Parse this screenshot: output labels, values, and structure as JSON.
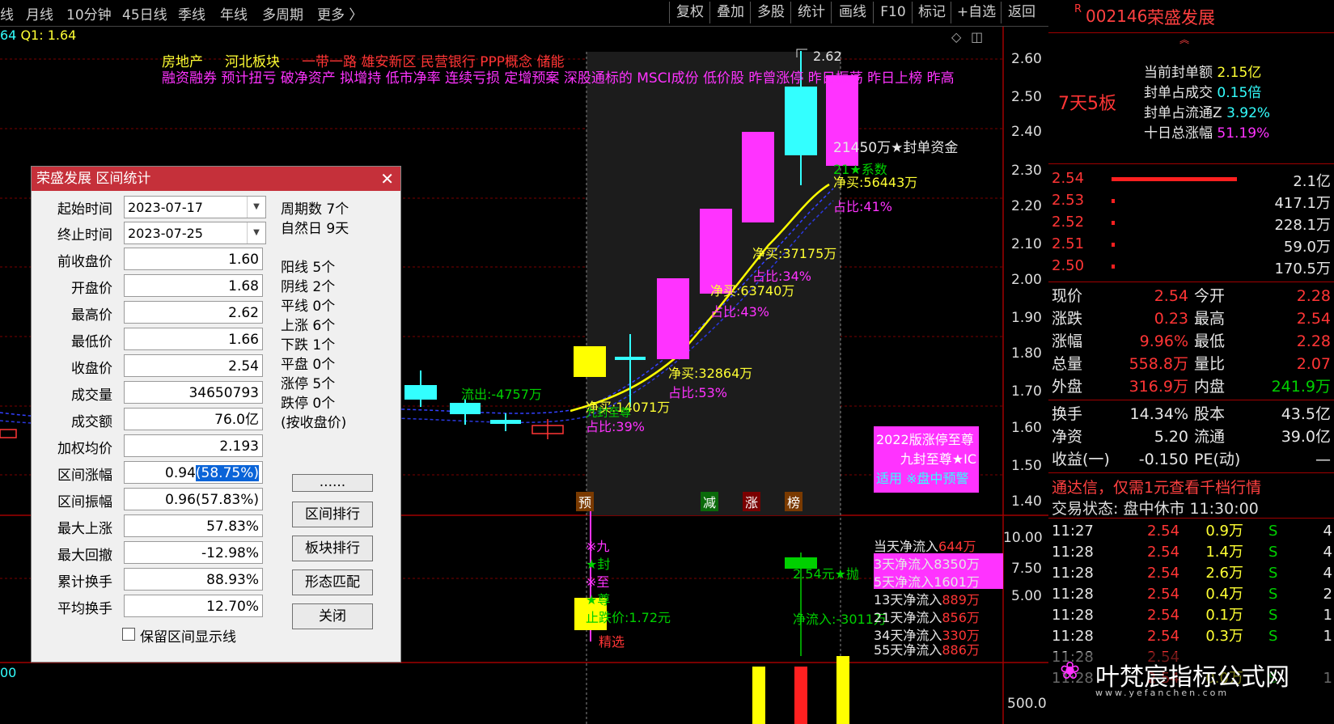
{
  "topbar": {
    "left_items": [
      "线",
      "月线",
      "10分钟",
      "45日线",
      "季线",
      "年线",
      "多周期",
      "更多 〉"
    ],
    "right_items": [
      "复权",
      "叠加",
      "多股",
      "统计",
      "画线",
      "F10",
      "标记",
      "+自选",
      "返回"
    ]
  },
  "chart_header": {
    "q_label_prefix": "64",
    "q_label": "Q1: 1.64"
  },
  "tags_line1": [
    "房地产",
    "河北板块",
    "一带一路",
    "雄安新区",
    "民营银行",
    "PPP概念",
    "储能"
  ],
  "tags_line2": "融资融券 预计扭亏 破净资产 拟增持 低市净率 连续亏损 定增预案 深股通标的 MSCI成份 低价股 昨曾涨停 昨日振荡 昨日上榜 昨高",
  "price_axis": [
    "2.60",
    "2.50",
    "2.40",
    "2.30",
    "2.20",
    "2.10",
    "2.00",
    "1.90",
    "1.80",
    "1.70",
    "1.60",
    "1.50",
    "1.40"
  ],
  "indicator_axis": [
    "10.00",
    "7.50",
    "5.00"
  ],
  "volume_axis": [
    "500.0"
  ],
  "vol_header": "00",
  "peak_label": "2.62",
  "annotations": {
    "outflow": "流出:-4757万",
    "net1": "净买:14071万",
    "ratio1": "占比:39%",
    "nine_seal": "九封至尊",
    "net2": "净买:32864万",
    "ratio2": "占比:53%",
    "net3": "净买:63740万",
    "ratio3": "占比:43%",
    "net4": "净买:37175万",
    "ratio4": "占比:34%",
    "seal_fund": "21450万★封单资金",
    "system": "21★系数",
    "net5": "净买:56443万",
    "ratio5": "占比:41%"
  },
  "markers": [
    "预",
    "减",
    "涨",
    "榜"
  ],
  "promo_box": {
    "line1": "2022版涨停至尊",
    "line2": "九封至尊★IC",
    "line3": "适用",
    "line4": "※盘中预警"
  },
  "indicator_annotations": {
    "v1": "※九",
    "v2": "★封",
    "v3": "※至",
    "v4": "★尊",
    "stop_price": "止跌价:1.72元",
    "sell_signal": "2.54元★抛",
    "net_inflow": "净流入:-3011万",
    "select": "精选"
  },
  "flow_list": [
    {
      "label": "当天净流入",
      "value": "644万"
    },
    {
      "label": "3天净流入",
      "value": "8350万"
    },
    {
      "label": "5天净流入",
      "value": "1601万"
    },
    {
      "label": "13天净流入",
      "value": "889万"
    },
    {
      "label": "21天净流入",
      "value": "856万"
    },
    {
      "label": "34天净流入",
      "value": "330万"
    },
    {
      "label": "55天净流入",
      "value": "886万"
    }
  ],
  "dialog": {
    "title": "荣盛发展 区间统计",
    "start_label": "起始时间",
    "start_value": "2023-07-17",
    "end_label": "终止时间",
    "end_value": "2023-07-25",
    "fields": [
      {
        "label": "前收盘价",
        "value": "1.60"
      },
      {
        "label": "开盘价",
        "value": "1.68"
      },
      {
        "label": "最高价",
        "value": "2.62"
      },
      {
        "label": "最低价",
        "value": "1.66"
      },
      {
        "label": "收盘价",
        "value": "2.54"
      },
      {
        "label": "成交量",
        "value": "34650793"
      },
      {
        "label": "成交额",
        "value": "76.0亿"
      },
      {
        "label": "加权均价",
        "value": "2.193"
      },
      {
        "label": "区间涨幅",
        "value": "0.94",
        "value_sel": "(58.75%)"
      },
      {
        "label": "区间振幅",
        "value": "0.96(57.83%)"
      },
      {
        "label": "最大上涨",
        "value": "57.83%"
      },
      {
        "label": "最大回撤",
        "value": "-12.98%"
      },
      {
        "label": "累计换手",
        "value": "88.93%"
      },
      {
        "label": "平均换手",
        "value": "12.70%"
      }
    ],
    "stats_top": [
      "周期数 7个",
      "自然日 9天"
    ],
    "stats": [
      "阳线 5个",
      "阴线 2个",
      "平线 0个",
      "上涨 6个",
      "下跌 1个",
      "平盘 0个",
      "涨停 5个",
      "跌停 0个",
      "(按收盘价)"
    ],
    "buttons": [
      "......",
      "区间排行",
      "板块排行",
      "形态匹配",
      "关闭"
    ],
    "checkbox_label": "保留区间显示线"
  },
  "right_panel": {
    "r_mark": "R",
    "code": "002146",
    "name": "荣盛发展",
    "board_tag": "7天5板",
    "info": [
      {
        "label": "当前封单额",
        "value": "2.15亿"
      },
      {
        "label": "封单占成交",
        "value": "0.15倍"
      },
      {
        "label": "封单占流通Z",
        "value": "3.92%"
      },
      {
        "label": "十日总涨幅",
        "value": "51.19%"
      }
    ],
    "bids": [
      {
        "price": "2.54",
        "vol": "2.1亿",
        "bar": 1.0
      },
      {
        "price": "2.53",
        "vol": "417.1万",
        "bar": 0.02
      },
      {
        "price": "2.52",
        "vol": "228.1万",
        "bar": 0.01
      },
      {
        "price": "2.51",
        "vol": "59.0万",
        "bar": 0.005
      },
      {
        "price": "2.50",
        "vol": "170.5万",
        "bar": 0.01
      }
    ],
    "quote": [
      {
        "l1": "现价",
        "v1": "2.54",
        "l2": "今开",
        "v2": "2.28"
      },
      {
        "l1": "涨跌",
        "v1": "0.23",
        "l2": "最高",
        "v2": "2.54"
      },
      {
        "l1": "涨幅",
        "v1": "9.96%",
        "l2": "最低",
        "v2": "2.28"
      },
      {
        "l1": "总量",
        "v1": "558.8万",
        "l2": "量比",
        "v2": "2.07"
      },
      {
        "l1": "外盘",
        "v1": "316.9万",
        "l2": "内盘",
        "v2": "241.9万"
      }
    ],
    "quote2": [
      {
        "l1": "换手",
        "v1": "14.34%",
        "l2": "股本",
        "v2": "43.5亿"
      },
      {
        "l1": "净资",
        "v1": "5.20",
        "l2": "流通",
        "v2": "39.0亿"
      },
      {
        "l1": "收益(一)",
        "v1": "-0.150",
        "l2": "PE(动)",
        "v2": "—"
      }
    ],
    "promo": "通达信，仅需1元查看千档行情",
    "trade_status": "交易状态: 盘中休市 11:30:00",
    "ticks": [
      {
        "time": "11:27",
        "price": "2.54",
        "vol": "0.9万",
        "side": "S",
        "n": "4"
      },
      {
        "time": "11:28",
        "price": "2.54",
        "vol": "1.4万",
        "side": "S",
        "n": "4"
      },
      {
        "time": "11:28",
        "price": "2.54",
        "vol": "2.6万",
        "side": "S",
        "n": "4"
      },
      {
        "time": "11:28",
        "price": "2.54",
        "vol": "0.4万",
        "side": "S",
        "n": "2"
      },
      {
        "time": "11:28",
        "price": "2.54",
        "vol": "0.1万",
        "side": "S",
        "n": "1"
      },
      {
        "time": "11:28",
        "price": "2.54",
        "vol": "0.3万",
        "side": "S",
        "n": "1"
      },
      {
        "time": "11:28",
        "price": "2.54",
        "vol": "",
        "side": "",
        "n": ""
      },
      {
        "time": "11:28",
        "price": "2.54",
        "vol": "0.0万",
        "side": "S",
        "n": "1"
      }
    ],
    "watermark": "叶梵宸指标公式网",
    "watermark_url": "www.yefanchen.com"
  },
  "colors": {
    "up": "#ff33ff",
    "up_strong": "#ff3535",
    "down": "#33ffff",
    "ma": "#ffff00",
    "bg": "#000000"
  }
}
